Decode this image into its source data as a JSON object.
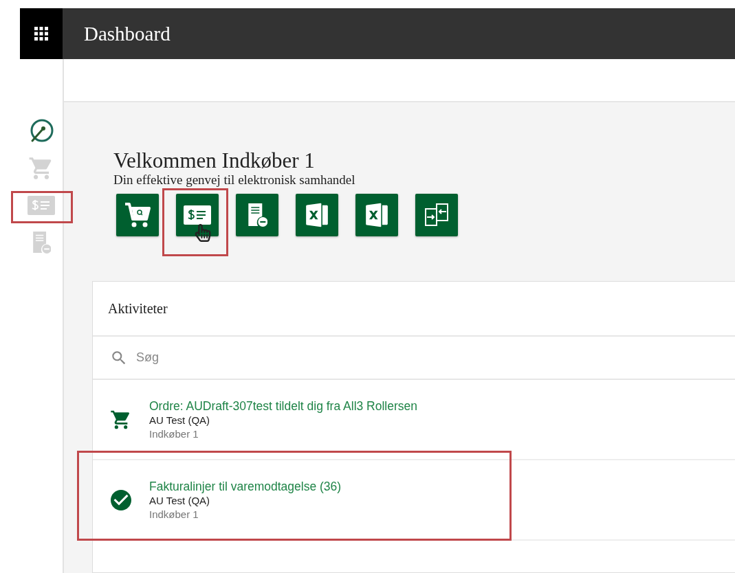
{
  "header": {
    "title": "Dashboard"
  },
  "sidebar": {
    "items": [
      {
        "kind": "gauge",
        "selected": true,
        "highlighted": false
      },
      {
        "kind": "cart",
        "selected": false,
        "highlighted": false
      },
      {
        "kind": "invoice",
        "selected": false,
        "highlighted": true
      },
      {
        "kind": "document",
        "selected": false,
        "highlighted": false
      }
    ]
  },
  "welcome": {
    "title": "Velkommen Indkøber 1",
    "subtitle": "Din effektive genvej til elektronisk samhandel"
  },
  "quick_actions": [
    {
      "kind": "cart",
      "highlighted": false,
      "hovered": false
    },
    {
      "kind": "invoice",
      "highlighted": true,
      "hovered": true
    },
    {
      "kind": "document",
      "highlighted": false,
      "hovered": false
    },
    {
      "kind": "excel",
      "highlighted": false,
      "hovered": false
    },
    {
      "kind": "excel",
      "highlighted": false,
      "hovered": false
    },
    {
      "kind": "exchange",
      "highlighted": false,
      "hovered": false
    }
  ],
  "activities": {
    "title": "Aktiviteter",
    "search": {
      "placeholder": "Søg"
    },
    "items": [
      {
        "kind": "order",
        "title": "Ordre: AUDraft-307test tildelt dig fra All3 Rollersen",
        "company": "AU Test (QA)",
        "user": "Indkøber 1",
        "highlighted": false
      },
      {
        "kind": "done",
        "title": "Fakturalinjer til varemodtagelse (36)",
        "company": "AU Test (QA)",
        "user": "Indkøber 1",
        "highlighted": true
      }
    ]
  }
}
